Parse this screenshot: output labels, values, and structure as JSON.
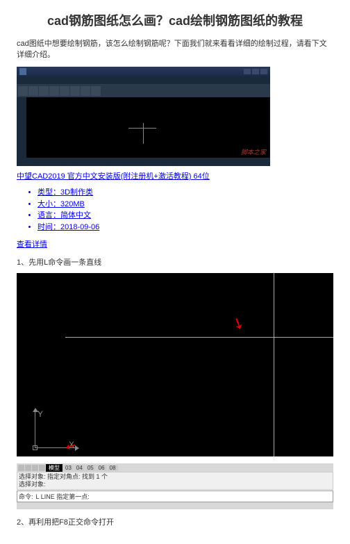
{
  "title": "cad钢筋图纸怎么画？cad绘制钢筋图纸的教程",
  "intro": "cad图纸中想要绘制钢筋，该怎么绘制钢筋呢？下面我们就来看看详细的绘制过程，请看下文详细介绍。",
  "cad_window": {
    "watermark": "脚本之家"
  },
  "download_link": "中望CAD2019 官方中文安装版(附注册机+激活教程) 64位",
  "meta": {
    "type_label": "类型：",
    "type_value": "3D制作类",
    "size_label": "大小：",
    "size_value": "320MB",
    "lang_label": "语言：",
    "lang_value": "简体中文",
    "time_label": "时间：",
    "time_value": "2018-09-06"
  },
  "detail_link": "查看详情",
  "step1": "1、先用L命令画一条直线",
  "axis": {
    "y": "Y",
    "x": "X"
  },
  "tabs": {
    "active": "模型",
    "t1": "03",
    "t2": "04",
    "t3": "05",
    "t4": "06",
    "t5": "08"
  },
  "cmd": {
    "line1": "选择对象: 指定对角点: 找到 1 个",
    "line2": "选择对象:",
    "label": "命令:",
    "text": "L LINE 指定第一点:"
  },
  "step2": "2、再利用把F8正交命令打开"
}
